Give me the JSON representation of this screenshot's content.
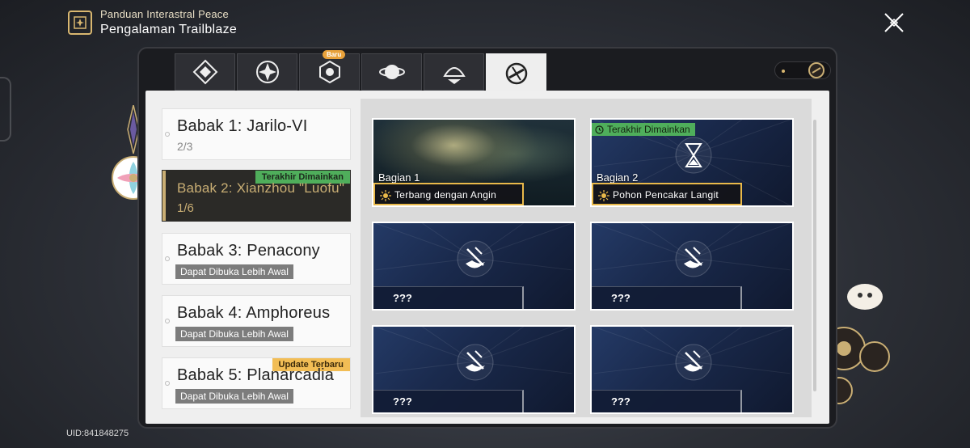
{
  "header": {
    "subtitle": "Panduan Interastral Peace",
    "title": "Pengalaman Trailblaze"
  },
  "uid": "UID:841848275",
  "tabs": [
    {
      "icon": "diamond-tiles-icon",
      "active": false
    },
    {
      "icon": "compass-star-icon",
      "active": false
    },
    {
      "icon": "emblem-icon",
      "active": false,
      "badge": "Baru"
    },
    {
      "icon": "planet-icon",
      "active": false
    },
    {
      "icon": "shell-icon",
      "active": false
    },
    {
      "icon": "trailblaze-icon",
      "active": true
    }
  ],
  "chapters": [
    {
      "title": "Babak 1: Jarilo-VI",
      "progress": "2/3",
      "active": false
    },
    {
      "title": "Babak 2: Xianzhou \"Luofu\"",
      "progress": "1/6",
      "active": true,
      "tag": "Terakhir Dimainkan"
    },
    {
      "title": "Babak 3: Penacony",
      "locked": "Dapat Dibuka Lebih Awal"
    },
    {
      "title": "Babak 4: Amphoreus",
      "locked": "Dapat Dibuka Lebih Awal"
    },
    {
      "title": "Babak 5: Planarcadia",
      "locked": "Dapat Dibuka Lebih Awal",
      "tag": "Update Terbaru"
    }
  ],
  "cards": [
    {
      "part": "Bagian 1",
      "label": "Terbang dengan Angin",
      "image": "forest"
    },
    {
      "part": "Bagian 2",
      "label": "Pohon Pencakar Langit",
      "tag": "Terakhir Dimainkan",
      "image": "hourglass"
    },
    {
      "label": "???",
      "image": "locked"
    },
    {
      "label": "???",
      "image": "locked"
    },
    {
      "label": "???",
      "image": "locked"
    },
    {
      "label": "???",
      "image": "locked"
    }
  ],
  "colors": {
    "accent_gold": "#c9ae74",
    "tag_green": "#4fae5b",
    "tag_orange": "#f2bd55",
    "card_blue": "#1a2a4d"
  }
}
